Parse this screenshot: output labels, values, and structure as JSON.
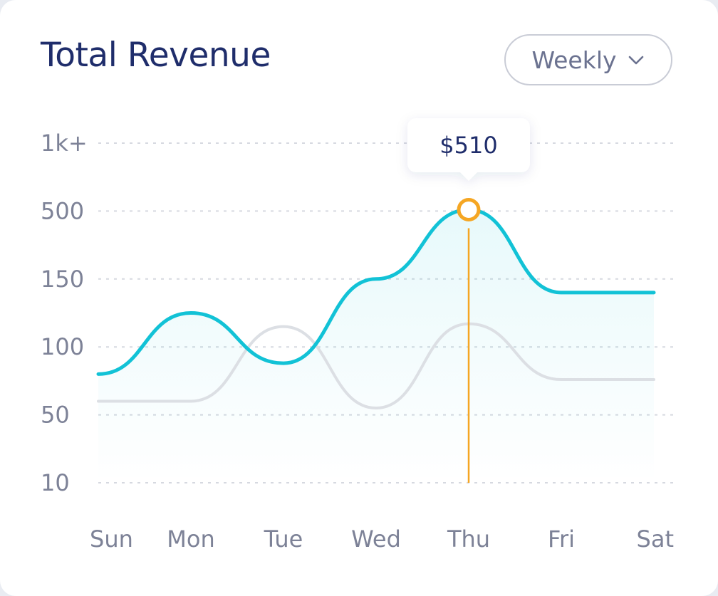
{
  "header": {
    "title": "Total Revenue",
    "period_selector": {
      "selected": "Weekly",
      "icon": "chevron-down-icon"
    }
  },
  "tooltip": {
    "value_label": "$510"
  },
  "colors": {
    "primary_series": "#12c2d6",
    "secondary_series": "#dcdfe4",
    "highlight": "#f5a623",
    "title": "#1f2d6b",
    "axis_text": "#7d8297",
    "grid": "#d6d9e0"
  },
  "chart_data": {
    "type": "area",
    "title": "Total Revenue",
    "xlabel": "",
    "ylabel": "",
    "y_ticks": [
      "10",
      "50",
      "100",
      "150",
      "500",
      "1k+"
    ],
    "y_scale": "categorical-step (ticks evenly spaced: 10, 50, 100, 150, 500, 1k+)",
    "categories": [
      "Sun",
      "Mon",
      "Tue",
      "Wed",
      "Thu",
      "Fri",
      "Sat"
    ],
    "series": [
      {
        "values": [
          80,
          125,
          88,
          150,
          510,
          140,
          140
        ],
        "style": "area-filled"
      },
      {
        "values": [
          60,
          60,
          115,
          55,
          117,
          76,
          76
        ],
        "style": "line"
      }
    ],
    "highlight": {
      "category": "Thu",
      "series_index": 0,
      "value": 510,
      "label": "$510"
    },
    "grid": true,
    "legend": "none"
  }
}
